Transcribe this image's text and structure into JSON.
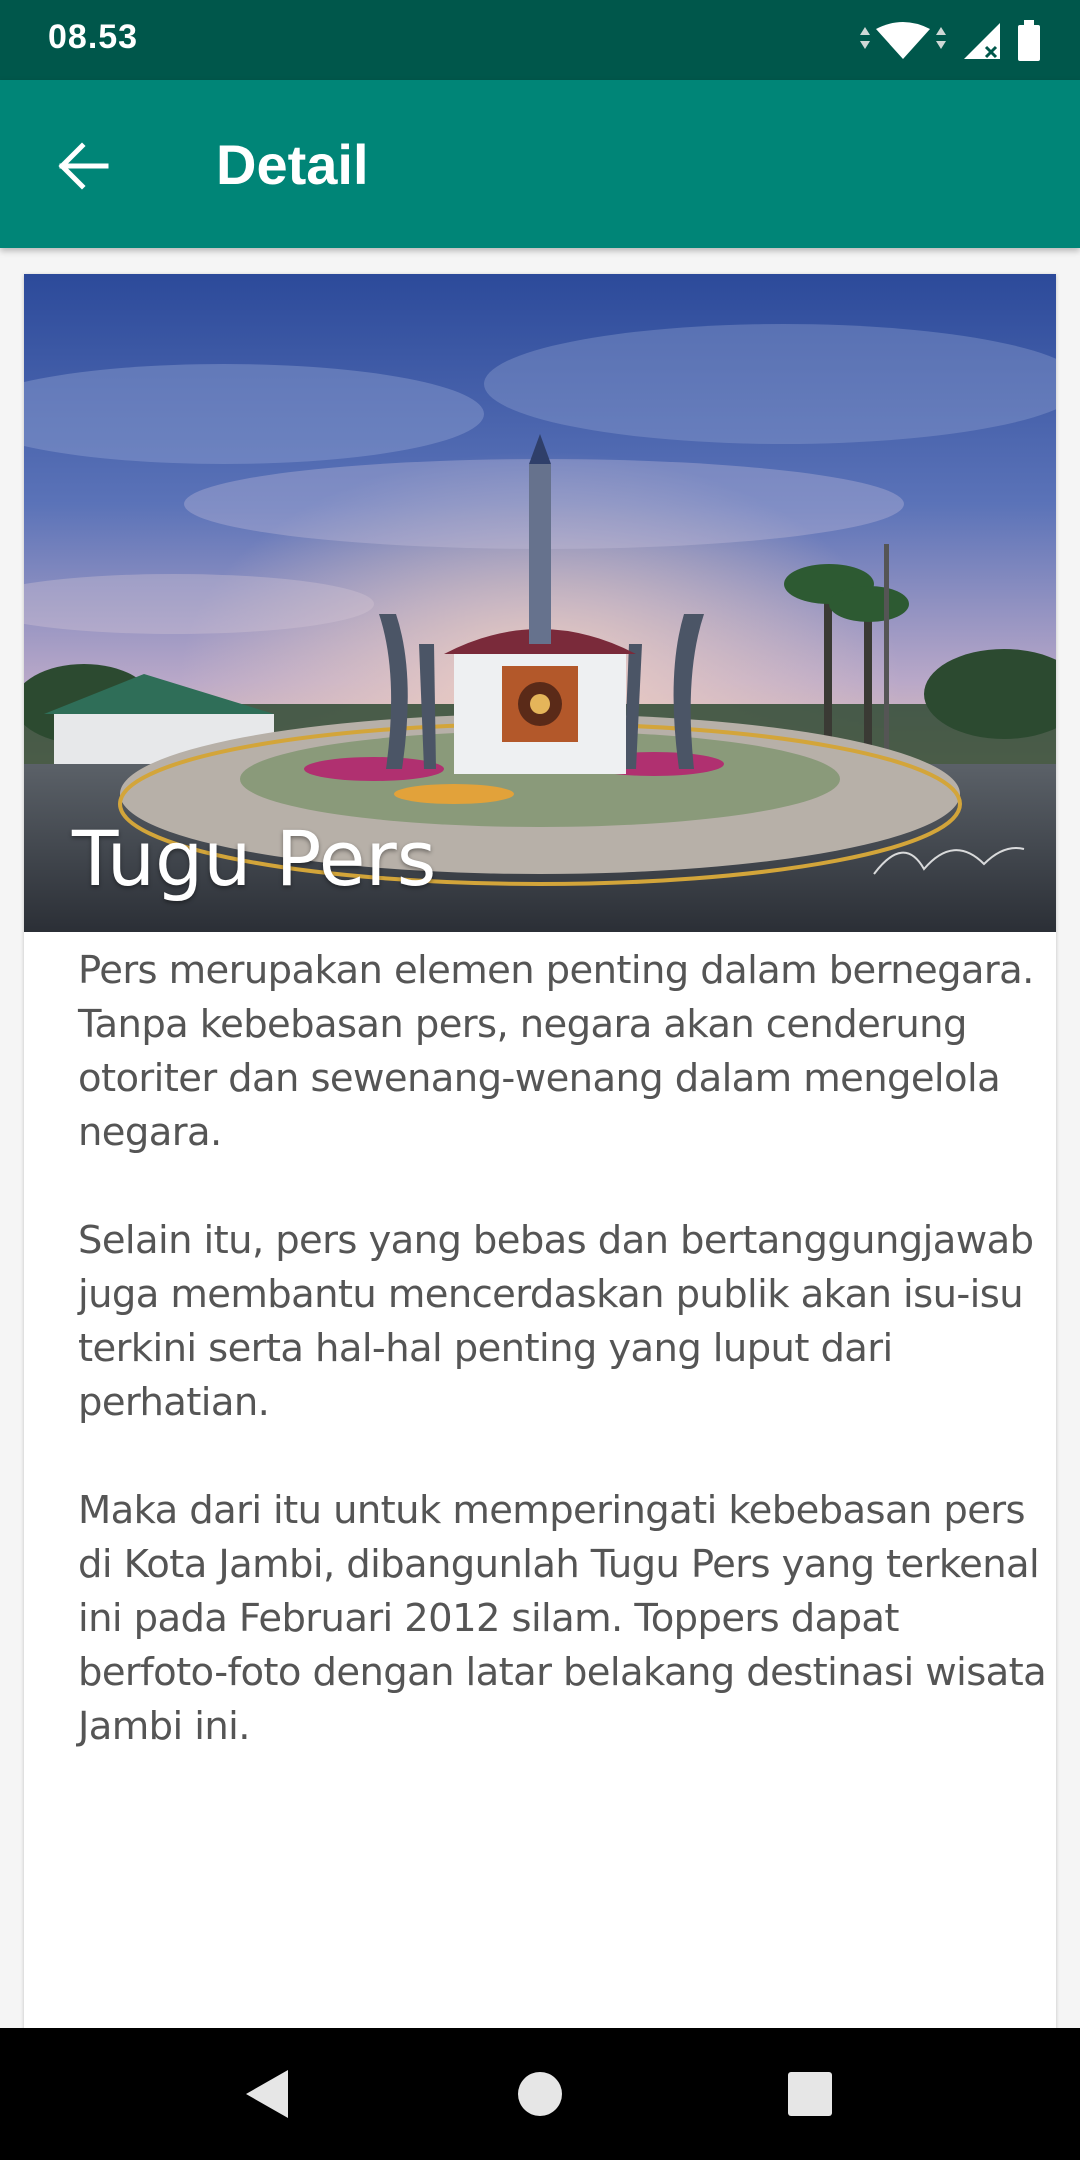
{
  "status_bar": {
    "time": "08.53"
  },
  "app_bar": {
    "title": "Detail"
  },
  "detail": {
    "title": "Tugu Pers",
    "description": "Pers merupakan elemen penting dalam bernegara. Tanpa kebebasan pers, negara akan cenderung otoriter dan sewenang-wenang dalam mengelola negara.\n\nSelain itu, pers yang bebas dan bertanggungjawab juga membantu mencerdaskan publik akan isu-isu terkini serta hal-hal penting yang luput dari perhatian.\n\nMaka dari itu untuk memperingati kebebasan pers di Kota Jambi, dibangunlah Tugu Pers yang terkenal ini pada Februari 2012 silam. Toppers dapat berfoto-foto dengan latar belakang destinasi wisata Jambi ini."
  },
  "icons": {
    "back": "arrow-back-icon",
    "wifi": "wifi-icon",
    "signal": "signal-icon",
    "battery": "battery-icon",
    "nav_back": "nav-back-icon",
    "nav_home": "nav-home-icon",
    "nav_recents": "nav-recents-icon"
  },
  "colors": {
    "status_bar": "#00574b",
    "app_bar": "#008577"
  }
}
